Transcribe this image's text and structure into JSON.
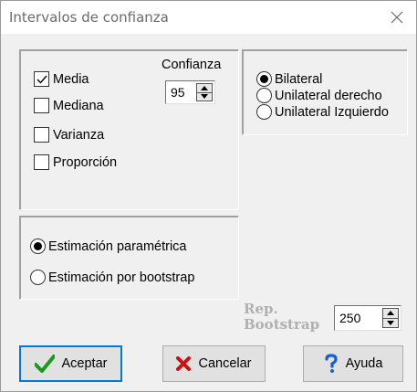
{
  "window": {
    "title": "Intervalos de confianza"
  },
  "statistics": [
    {
      "label": "Media",
      "checked": true
    },
    {
      "label": "Mediana",
      "checked": false
    },
    {
      "label": "Varianza",
      "checked": false
    },
    {
      "label": "Proporción",
      "checked": false
    }
  ],
  "confidence": {
    "label": "Confianza",
    "value": "95"
  },
  "sides": [
    {
      "label": "Bilateral",
      "selected": true
    },
    {
      "label": "Unilateral derecho",
      "selected": false
    },
    {
      "label": "Unilateral Izquierdo",
      "selected": false
    }
  ],
  "estimation": [
    {
      "label": "Estimación paramétrica",
      "selected": true
    },
    {
      "label": "Estimación por bootstrap",
      "selected": false
    }
  ],
  "bootstrap": {
    "label_line1": "Rep.",
    "label_line2": "Bootstrap",
    "value": "250"
  },
  "buttons": {
    "accept": "Aceptar",
    "cancel": "Cancelar",
    "help": "Ayuda"
  },
  "colors": {
    "accent": "#0078d7",
    "check_green": "#1a9a1a",
    "cancel_red": "#cc1111",
    "help_blue": "#1560d0"
  }
}
